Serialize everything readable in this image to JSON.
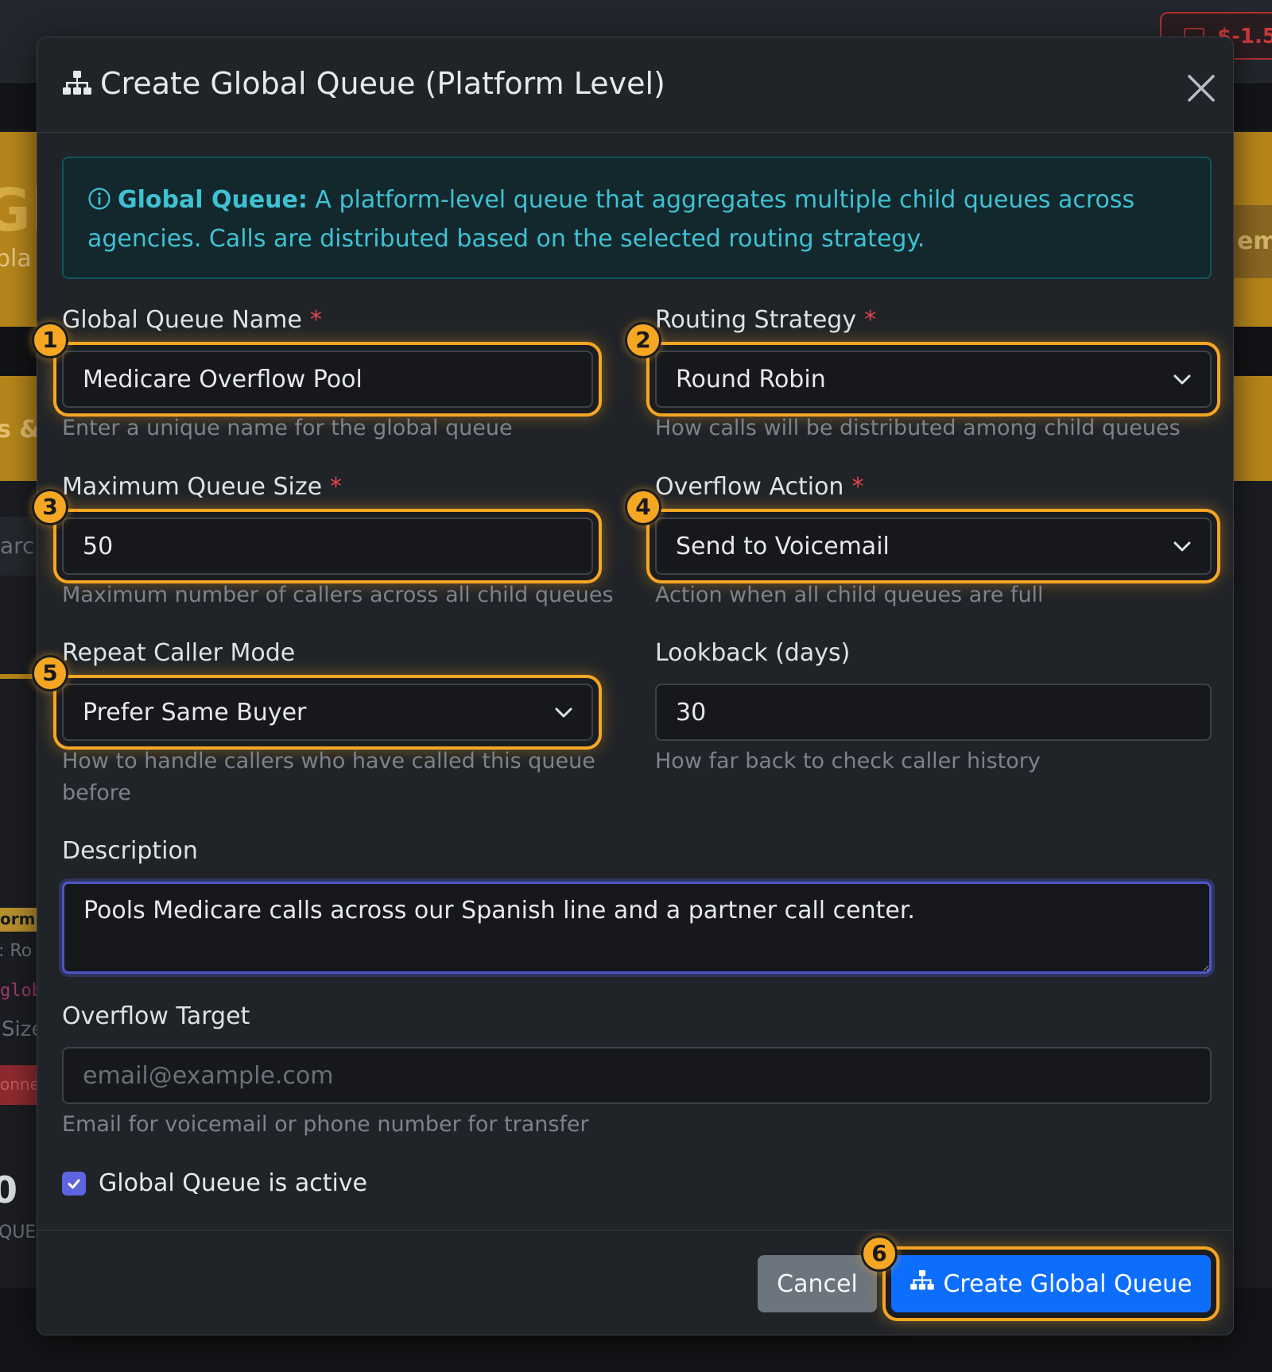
{
  "background": {
    "wallet_amount": "$-1.5",
    "hero_title": "Gl",
    "hero_subtitle": "pla",
    "hero_button": "em",
    "section_label": "s &",
    "search_text": "arc",
    "badge_text": "orm",
    "row_text_1": ": Ro",
    "row_code": "glob",
    "row_text_2": "Size",
    "status_text": "onne",
    "stat_value": "0",
    "stat_label": "QUE"
  },
  "modal": {
    "title": "Create Global Queue (Platform Level)",
    "title_icon": "sitemap-icon",
    "close_icon": "close-icon"
  },
  "alert": {
    "icon": "info-circle-icon",
    "bold": "Global Queue:",
    "text": "A platform-level queue that aggregates multiple child queues across agencies. Calls are distributed based on the selected routing strategy."
  },
  "form": {
    "name": {
      "label": "Global Queue Name",
      "required": "*",
      "value": "Medicare Overflow Pool",
      "help": "Enter a unique name for the global queue",
      "marker": "1"
    },
    "routing": {
      "label": "Routing Strategy",
      "required": "*",
      "value": "Round Robin",
      "help": "How calls will be distributed among child queues",
      "marker": "2"
    },
    "max_size": {
      "label": "Maximum Queue Size",
      "required": "*",
      "value": "50",
      "help": "Maximum number of callers across all child queues",
      "marker": "3"
    },
    "overflow_action": {
      "label": "Overflow Action",
      "required": "*",
      "value": "Send to Voicemail",
      "help": "Action when all child queues are full",
      "marker": "4"
    },
    "repeat_caller": {
      "label": "Repeat Caller Mode",
      "value": "Prefer Same Buyer",
      "help": "How to handle callers who have called this queue before",
      "marker": "5"
    },
    "lookback": {
      "label": "Lookback (days)",
      "value": "30",
      "help": "How far back to check caller history"
    },
    "description": {
      "label": "Description",
      "value": "Pools Medicare calls across our Spanish line and a partner call center."
    },
    "overflow_target": {
      "label": "Overflow Target",
      "placeholder": "email@example.com",
      "help": "Email for voicemail or phone number for transfer"
    },
    "active": {
      "label": "Global Queue is active",
      "checked": true
    }
  },
  "footer": {
    "cancel_label": "Cancel",
    "submit_label": "Create Global Queue",
    "submit_icon": "sitemap-icon",
    "marker": "6"
  },
  "colors": {
    "highlight": "#f5a623",
    "primary": "#0d6efd",
    "info": "#3fc1d4",
    "required": "#e0454b",
    "checkbox": "#5e63e0"
  }
}
